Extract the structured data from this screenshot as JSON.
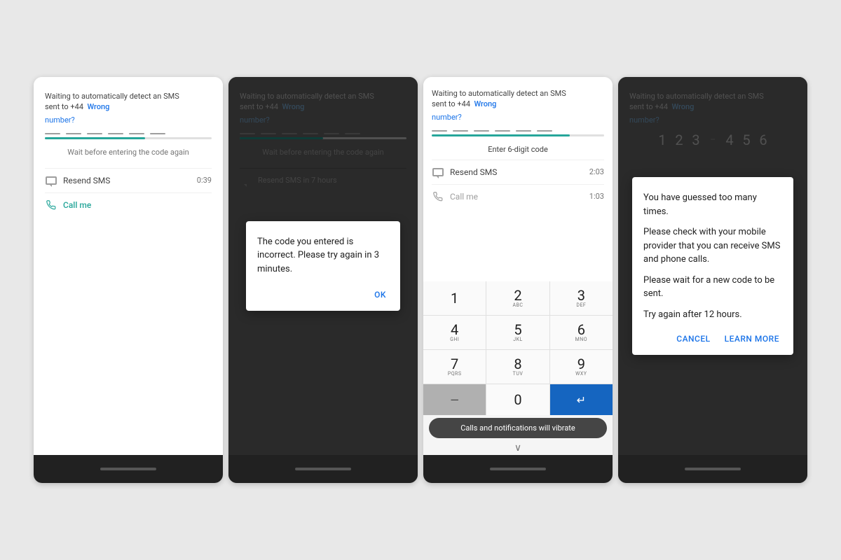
{
  "screens": [
    {
      "id": "screen1",
      "type": "normal",
      "header": {
        "line1": "Waiting to automatically detect an SMS",
        "line2": "sent to +44",
        "wrong": "Wrong",
        "number_link": "number?"
      },
      "code_dots": [
        "",
        "",
        "",
        "",
        "",
        ""
      ],
      "progress": 60,
      "status_text": "Wait before entering the code again",
      "resend": {
        "label": "Resend SMS",
        "timer": "0:39"
      },
      "call": {
        "label": "Call me",
        "show": true
      }
    },
    {
      "id": "screen2",
      "type": "overlay_dialog",
      "header": {
        "line1": "Waiting to automatically detect an SMS",
        "line2": "sent to +44",
        "wrong": "Wrong",
        "number_link": "number?"
      },
      "code_dots": [
        "",
        "",
        "",
        "",
        "",
        ""
      ],
      "progress": 50,
      "status_text": "Wait before entering the code again",
      "resend": {
        "label": "Resend SMS in 7 hours",
        "timer": ""
      },
      "dialog": {
        "message": "The code you entered is incorrect. Please try again in 3 minutes.",
        "ok_label": "OK"
      }
    },
    {
      "id": "screen3",
      "type": "numpad",
      "header": {
        "line1": "Waiting to automatically detect an SMS",
        "line2": "sent to +44",
        "wrong": "Wrong",
        "number_link": "number?"
      },
      "code_dots": [
        "",
        "",
        "",
        "",
        "",
        ""
      ],
      "progress": 80,
      "enter_code": "Enter 6-digit code",
      "resend": {
        "label": "Resend SMS",
        "timer": "2:03"
      },
      "call": {
        "label": "Call me",
        "timer": "1:03"
      },
      "numpad_keys": [
        {
          "num": "1",
          "letters": ""
        },
        {
          "num": "2",
          "letters": "ABC"
        },
        {
          "num": "3",
          "letters": "DEF"
        },
        {
          "num": "4",
          "letters": "GHI"
        },
        {
          "num": "5",
          "letters": "JKL"
        },
        {
          "num": "6",
          "letters": "MNO"
        },
        {
          "num": "7",
          "letters": "PQRS"
        },
        {
          "num": "8",
          "letters": "TUV"
        },
        {
          "num": "9",
          "letters": "WXY"
        },
        {
          "num": "back",
          "letters": ""
        },
        {
          "num": "0",
          "letters": ""
        },
        {
          "num": "enter",
          "letters": ""
        }
      ],
      "vibrate_text": "Calls and notifications will vibrate",
      "chevron": "∨"
    },
    {
      "id": "screen4",
      "type": "overlay_dialog2",
      "header": {
        "line1": "Waiting to automatically detect an SMS",
        "line2": "sent to +44",
        "wrong": "Wrong",
        "number_link": "number?"
      },
      "digits": [
        "1",
        "2",
        "3",
        "-",
        "4",
        "5",
        "6"
      ],
      "dialog": {
        "message1": "You have guessed too many times.",
        "message2": "Please check with your mobile provider that you can receive SMS and phone calls.",
        "message3": "Please wait for a new code to be sent.",
        "message4": "Try again after 12 hours.",
        "cancel_label": "CANCEL",
        "learn_label": "LEARN MORE"
      }
    }
  ]
}
